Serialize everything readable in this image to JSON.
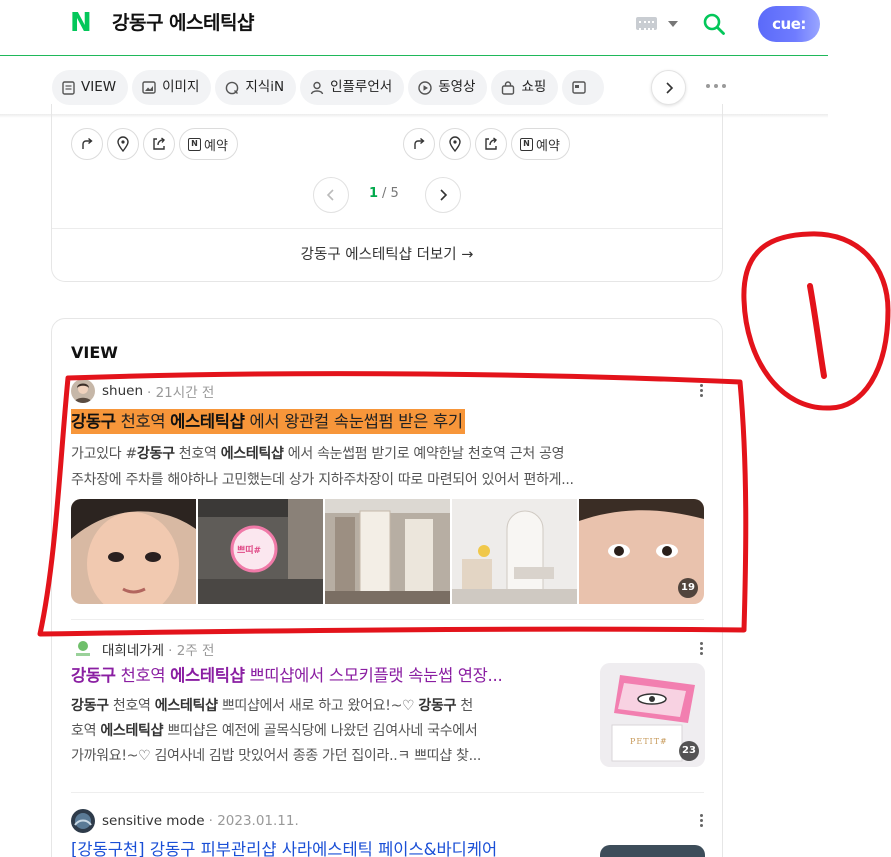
{
  "header": {
    "logo": "N",
    "query": "강동구 에스테틱샵",
    "cue_label": "cue:"
  },
  "tabs": [
    {
      "label": "VIEW",
      "icon": "document-icon"
    },
    {
      "label": "이미지",
      "icon": "image-icon"
    },
    {
      "label": "지식iN",
      "icon": "q-bubble-icon"
    },
    {
      "label": "인플루언서",
      "icon": "person-icon"
    },
    {
      "label": "동영상",
      "icon": "play-icon"
    },
    {
      "label": "쇼핑",
      "icon": "bag-icon"
    }
  ],
  "place": {
    "reserve_label": "예약",
    "page_current": "1",
    "page_total": "/ 5",
    "more_label": "강동구 에스테틱샵 더보기 →"
  },
  "view": {
    "section_title": "VIEW",
    "posts": [
      {
        "author": "shuen",
        "time": "· 21시간 전",
        "title_parts": [
          "강동구",
          " 천호역 ",
          "에스테틱샵",
          " 에서 왕관컬 속눈썹펌 받은 후기"
        ],
        "desc_line1_parts": [
          "가고있다 #",
          "강동구",
          " 천호역 ",
          "에스테틱샵",
          " 에서 속눈썹펌 받기로 예약한날 천호역 근처 공영"
        ],
        "desc_line2": "주차장에 주차를 해야하나 고민했는데 상가 지하주차장이 따로 마련되어 있어서 편하게...",
        "image_count": "19",
        "sign_text": "쁘띠#"
      },
      {
        "author": "대희네가게",
        "time": "· 2주 전",
        "title_parts": [
          "강동구",
          " 천호역 ",
          "에스테틱샵",
          " 쁘띠샵에서 스모키플랫 속눈썹 연장..."
        ],
        "desc_line1_parts": [
          "강동구",
          " 천호역 ",
          "에스테틱샵",
          " 쁘띠샵에서 새로 하고 왔어요!~♡ ",
          "강동구",
          " 천"
        ],
        "desc_line2_parts": [
          "호역 ",
          "에스테틱샵",
          " 쁘띠샵은 예전에 골목식당에 나왔던 김여사네 국수에서"
        ],
        "desc_line3": "가까워요!~♡ 김여사네 김밥 맛있어서 종종 가던 집이라..ㅋ 쁘띠샵 찾...",
        "image_count": "23",
        "thumb_text": "PETIT#"
      },
      {
        "author": "sensitive mode",
        "time": "· 2023.01.11.",
        "title": "[강동구천] 강동구 피부관리샵 사라에스테틱 페이스&바디케어"
      }
    ]
  },
  "colors": {
    "naver_green": "#03c75a",
    "highlight_orange": "#f7963a",
    "visited_purple": "#8a1ea2",
    "link_blue": "#1a4fd6",
    "annotation_red": "#e3131b"
  },
  "annotation": {
    "label": "①"
  }
}
